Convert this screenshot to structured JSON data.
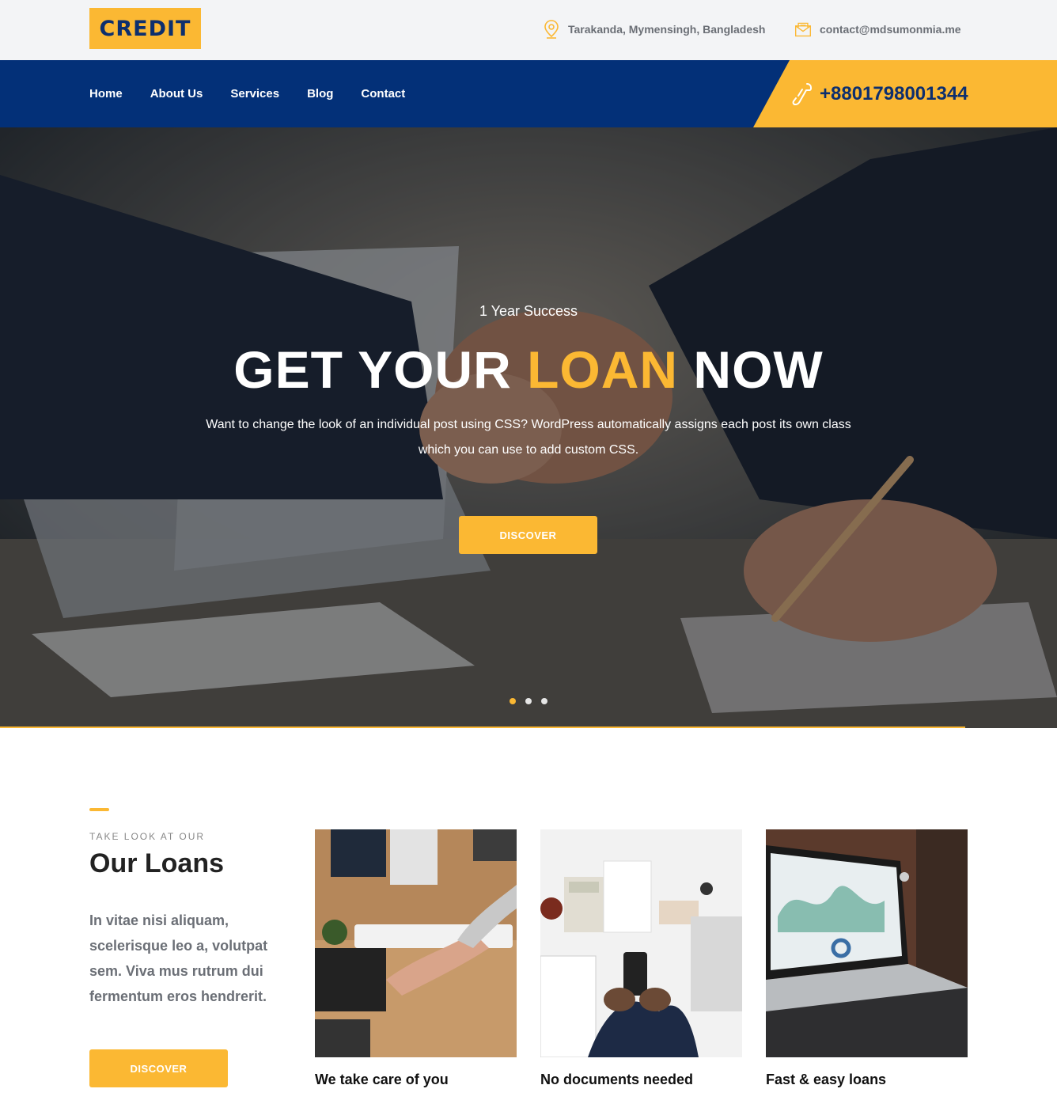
{
  "brand": {
    "logo_text": "CREDIT",
    "accent_color": "#fbb833",
    "primary_color": "#033078"
  },
  "topbar": {
    "address": {
      "icon": "map-pin-icon",
      "text": "Tarakanda, Mymensingh, Bangladesh"
    },
    "email": {
      "icon": "envelope-icon",
      "text": "contact@mdsumonmia.me"
    }
  },
  "nav": {
    "items": [
      {
        "label": "Home"
      },
      {
        "label": "About Us"
      },
      {
        "label": "Services"
      },
      {
        "label": "Blog"
      },
      {
        "label": "Contact"
      }
    ],
    "phone": {
      "icon": "phone-icon",
      "text": "+8801798001344"
    }
  },
  "hero": {
    "kicker": "1 Year Success",
    "title_part1": "GET YOUR ",
    "title_accent": "LOAN",
    "title_part2": " NOW",
    "description": "Want to change the look of an individual post using CSS? WordPress automatically assigns each post its own class which you can use to add custom CSS.",
    "button_label": "DISCOVER",
    "slides": {
      "count": 3,
      "active": 1
    }
  },
  "loans": {
    "eyebrow": "TAKE LOOK AT OUR",
    "title": "Our Loans",
    "description": "In vitae nisi aliquam, scelerisque leo a, volutpat sem. Viva mus rutrum dui fermentum eros hendrerit.",
    "button_label": "DISCOVER",
    "cards": [
      {
        "title": "We take care of you"
      },
      {
        "title": "No documents needed"
      },
      {
        "title": "Fast & easy loans"
      }
    ]
  }
}
